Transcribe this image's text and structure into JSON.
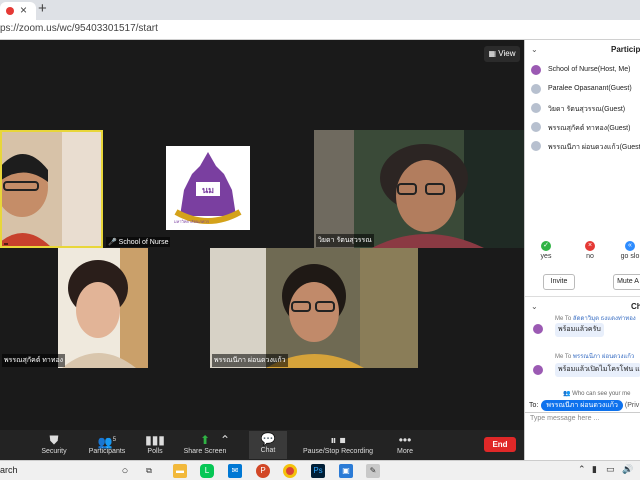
{
  "browser": {
    "url": "ps://zoom.us/wc/95403301517/start",
    "tab_close": "×",
    "new_tab": "+"
  },
  "meeting": {
    "view_label": "View",
    "tiles": [
      {
        "label": ""
      },
      {
        "label": "School of Nurse"
      },
      {
        "label": "วิยดา รัตนสุวรรณ"
      },
      {
        "label": "พรรณสุกัคต์ ทาทอง"
      },
      {
        "label": "พรรณนีภา ผ่อนดวงแก้ว"
      }
    ],
    "logo_text": "มหาวิทยาลัยนเรศวร"
  },
  "toolbar": {
    "security": "Security",
    "participants": "Participants",
    "participants_count": "5",
    "polls": "Polls",
    "share_screen": "Share Screen",
    "chat": "Chat",
    "record": "Pause/Stop Recording",
    "more": "More",
    "end": "End"
  },
  "participants_panel": {
    "title": "Particip",
    "items": [
      {
        "name": "School of Nurse(Host, Me)"
      },
      {
        "name": "Paralee Opasanant(Guest)"
      },
      {
        "name": "วิยดา รัตนสุวรรณ(Guest)"
      },
      {
        "name": "พรรณสุกัคต์ ทาทอง(Guest)"
      },
      {
        "name": "พรรณนีภา ผ่อนดวงแก้ว(Guest)"
      }
    ],
    "reactions": [
      {
        "label": "yes",
        "color": "#2fb344"
      },
      {
        "label": "no",
        "color": "#e53935"
      },
      {
        "label": "go slo",
        "color": "#2d8cff"
      }
    ],
    "invite": "Invite",
    "mute_all": "Mute A"
  },
  "chat_panel": {
    "title": "Ch",
    "messages": [
      {
        "to_prefix": "Me To",
        "to_name": "ลัดดาวิมุต ธงแดงท่าทอง",
        "text": "พร้อมแล้วครับ"
      },
      {
        "to_prefix": "Me To",
        "to_name": "พรรณนีภา ผ่อนดวงแก้ว",
        "text": "พร้อมแล้วเปิดไมโครโฟน และ"
      }
    ],
    "note": "Who can see your me",
    "to_label": "To:",
    "to_recipient": "พรรณนีภา ผ่อนดวงแก้ว",
    "to_privacy": "(Priv",
    "input_placeholder": "Type message here ..."
  },
  "taskbar": {
    "search": "arch",
    "apps": [
      {
        "icon": "cortana-icon",
        "color": "#333333"
      },
      {
        "icon": "taskview-icon",
        "color": "#333333"
      },
      {
        "icon": "file-explorer-icon",
        "color": "#f2b93b"
      },
      {
        "icon": "line-icon",
        "color": "#06c755"
      },
      {
        "icon": "mail-icon",
        "color": "#0078d4"
      },
      {
        "icon": "powerpoint-icon",
        "color": "#d24726"
      },
      {
        "icon": "chrome-icon",
        "color": "#db4437"
      },
      {
        "icon": "photoshop-icon",
        "color": "#001e36"
      },
      {
        "icon": "image-viewer-icon",
        "color": "#2b7bd6"
      },
      {
        "icon": "paint-icon",
        "color": "#8e8e8e"
      }
    ]
  }
}
